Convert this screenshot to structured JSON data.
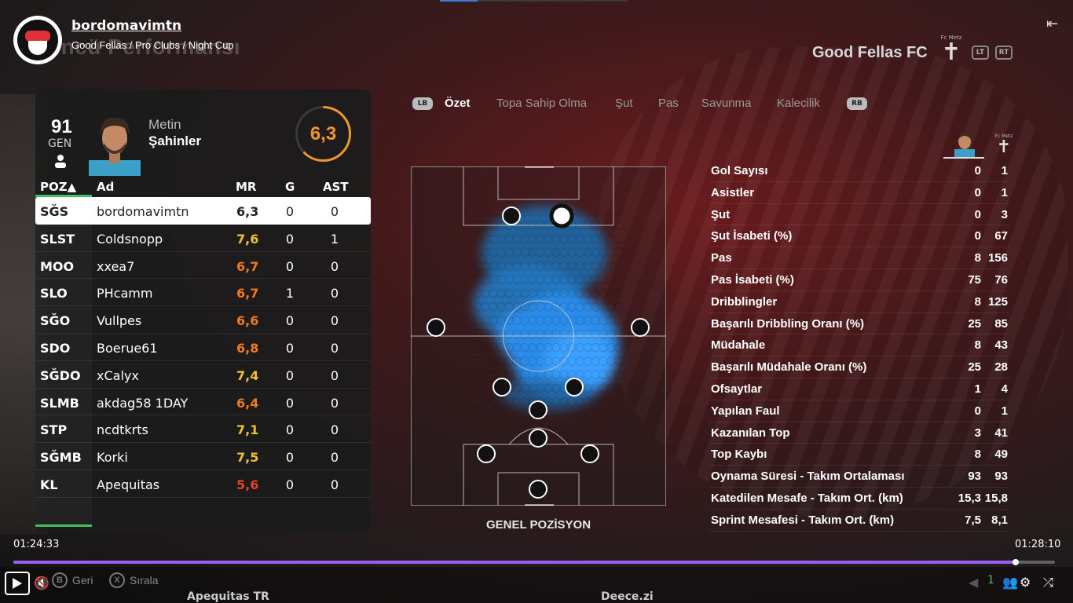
{
  "channel": {
    "name": "bordomavimtn",
    "breadcrumb": "Good Fellas / Pro Clubs / Night Cup"
  },
  "background_title": "uncü Performansı",
  "header": {
    "team_name": "Good Fellas  FC",
    "club_label": "Fc Metz",
    "lt_label": "LT",
    "rt_label": "RT",
    "exit_icon": "exit-icon"
  },
  "player": {
    "overall": "91",
    "overall_label": "GEN",
    "first_name": "Metin",
    "last_name": "Şahinler",
    "match_rating": "6,3",
    "match_rating_fraction": 0.63
  },
  "table": {
    "headers": {
      "pos": "POZ▲",
      "name": "Ad",
      "mr": "MR",
      "g": "G",
      "ast": "AST"
    },
    "rows": [
      {
        "pos": "SĞS",
        "name": "bordomavimtn",
        "mr": "6,3",
        "g": "0",
        "ast": "0",
        "mr_color": "#222222"
      },
      {
        "pos": "SLST",
        "name": "Coldsnopp",
        "mr": "7,6",
        "g": "0",
        "ast": "1",
        "mr_color": "#f0c030"
      },
      {
        "pos": "MOO",
        "name": "xxea7",
        "mr": "6,7",
        "g": "0",
        "ast": "0",
        "mr_color": "#f07a20"
      },
      {
        "pos": "SLO",
        "name": "PHcamm",
        "mr": "6,7",
        "g": "1",
        "ast": "0",
        "mr_color": "#f07a20"
      },
      {
        "pos": "SĞO",
        "name": "Vullpes",
        "mr": "6,6",
        "g": "0",
        "ast": "0",
        "mr_color": "#f07a20"
      },
      {
        "pos": "SDO",
        "name": "Boerue61",
        "mr": "6,8",
        "g": "0",
        "ast": "0",
        "mr_color": "#f07a20"
      },
      {
        "pos": "SĞDO",
        "name": "xCalyx",
        "mr": "7,4",
        "g": "0",
        "ast": "0",
        "mr_color": "#f0c030"
      },
      {
        "pos": "SLMB",
        "name": "akdag58 1DAY",
        "mr": "6,4",
        "g": "0",
        "ast": "0",
        "mr_color": "#f07a20"
      },
      {
        "pos": "STP",
        "name": "ncdtkrts",
        "mr": "7,1",
        "g": "0",
        "ast": "0",
        "mr_color": "#f0c030"
      },
      {
        "pos": "SĞMB",
        "name": "Korki",
        "mr": "7,5",
        "g": "0",
        "ast": "0",
        "mr_color": "#f0c030"
      },
      {
        "pos": "KL",
        "name": "Apequitas",
        "mr": "5,6",
        "g": "0",
        "ast": "0",
        "mr_color": "#e8402a"
      }
    ]
  },
  "tabs": {
    "lb": "LB",
    "rb": "RB",
    "items": [
      "Özet",
      "Topa Sahip Olma",
      "Şut",
      "Pas",
      "Savunma",
      "Kalecilik"
    ]
  },
  "pitch": {
    "label": "GENEL POZİSYON"
  },
  "stats": {
    "club_label": "Fc Metz",
    "rows": [
      {
        "label": "Gol Sayısı",
        "player": "0",
        "team": "1"
      },
      {
        "label": "Asistler",
        "player": "0",
        "team": "1"
      },
      {
        "label": "Şut",
        "player": "0",
        "team": "3"
      },
      {
        "label": "Şut İsabeti (%)",
        "player": "0",
        "team": "67"
      },
      {
        "label": "Pas",
        "player": "8",
        "team": "156"
      },
      {
        "label": "Pas İsabeti (%)",
        "player": "75",
        "team": "76"
      },
      {
        "label": "Dribblingler",
        "player": "8",
        "team": "125"
      },
      {
        "label": "Başarılı Dribbling Oranı (%)",
        "player": "25",
        "team": "85"
      },
      {
        "label": "Müdahale",
        "player": "8",
        "team": "43"
      },
      {
        "label": "Başarılı Müdahale Oranı (%)",
        "player": "25",
        "team": "28"
      },
      {
        "label": "Ofsaytlar",
        "player": "1",
        "team": "4"
      },
      {
        "label": "Yapılan Faul",
        "player": "0",
        "team": "1"
      },
      {
        "label": "Kazanılan Top",
        "player": "3",
        "team": "41"
      },
      {
        "label": "Top Kaybı",
        "player": "8",
        "team": "49"
      },
      {
        "label": "Oynama Süresi - Takım Ortalaması",
        "player": "93",
        "team": "93"
      },
      {
        "label": "Katedilen Mesafe - Takım Ort. (km)",
        "player": "15,3",
        "team": "15,8"
      },
      {
        "label": "Sprint Mesafesi - Takım Ort. (km)",
        "player": "7,5",
        "team": "8,1"
      }
    ]
  },
  "player_bar": {
    "current_time": "01:24:33",
    "duration": "01:28:10",
    "progress_fraction": 0.962,
    "hint_back_key": "B",
    "hint_back": "Geri",
    "hint_sort_key": "X",
    "hint_sort": "Sırala",
    "viewer_count": "1",
    "bottom_left_name": "Apequitas  TR",
    "bottom_right_name": "Deece.zi"
  },
  "colors": {
    "accent_purple": "#9b5ef5",
    "rating_orange": "#f0962b",
    "heat_blue": "#2b8ce8",
    "sort_green": "#40c060"
  }
}
